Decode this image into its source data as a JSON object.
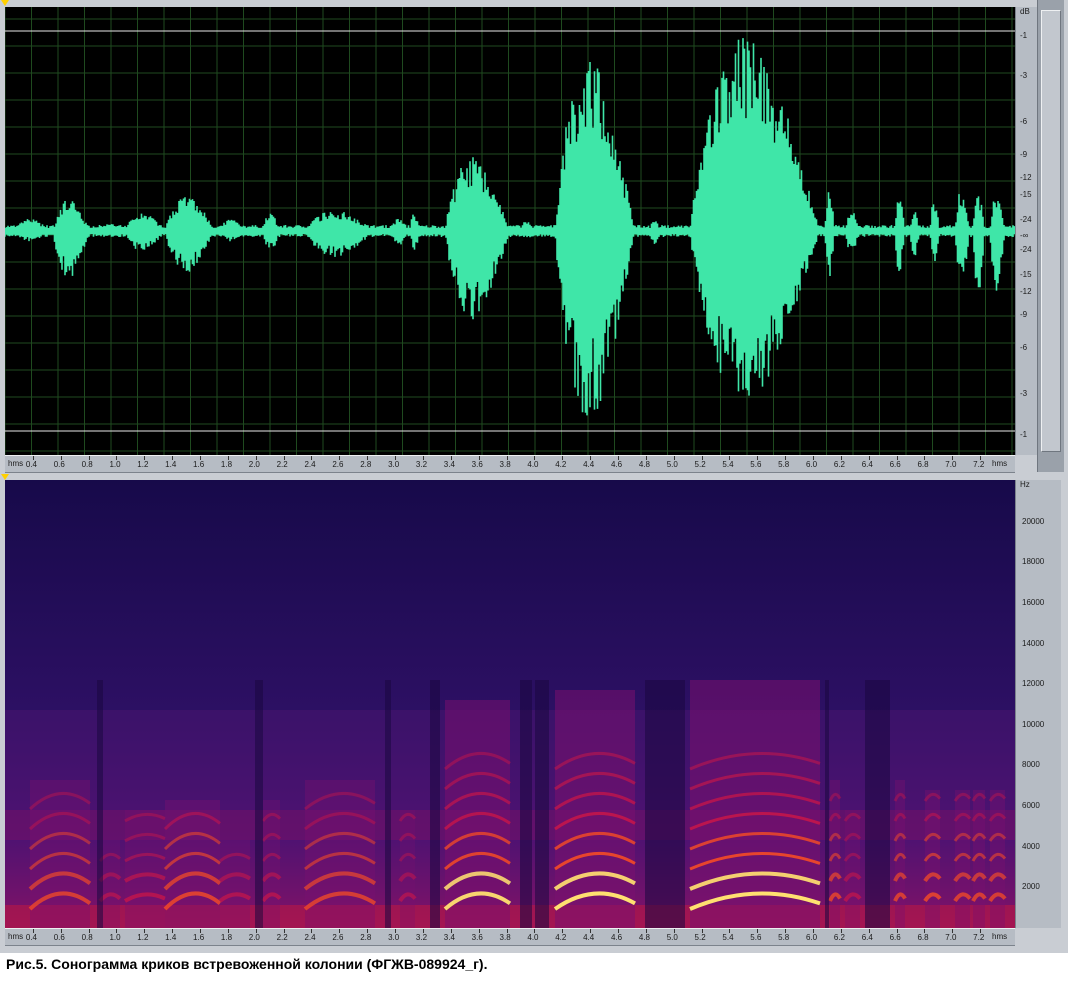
{
  "waveform": {
    "db_unit": "dB",
    "db_labels_top": [
      "-1",
      "-3",
      "-6",
      "-9",
      "-12",
      "-15",
      "-24",
      "-∞",
      "-24",
      "-15",
      "-12",
      "-9",
      "-6",
      "-3",
      "-1"
    ],
    "time_unit": "hms",
    "time_ticks": [
      "0.4",
      "0.6",
      "0.8",
      "1.0",
      "1.2",
      "1.4",
      "1.6",
      "1.8",
      "2.0",
      "2.2",
      "2.4",
      "2.6",
      "2.8",
      "3.0",
      "3.2",
      "3.4",
      "3.6",
      "3.8",
      "4.0",
      "4.2",
      "4.4",
      "4.6",
      "4.8",
      "5.0",
      "5.2",
      "5.4",
      "5.6",
      "5.8",
      "6.0",
      "6.2",
      "6.4",
      "6.6",
      "6.8",
      "7.0",
      "7.2"
    ],
    "color": "#3fe6a8",
    "time_range_s": [
      0.2,
      7.45
    ]
  },
  "spectrogram": {
    "freq_unit": "Hz",
    "freq_labels": [
      "20000",
      "18000",
      "16000",
      "14000",
      "12000",
      "10000",
      "8000",
      "6000",
      "4000",
      "2000"
    ],
    "time_unit": "hms",
    "time_ticks": [
      "0.4",
      "0.6",
      "0.8",
      "1.0",
      "1.2",
      "1.4",
      "1.6",
      "1.8",
      "2.0",
      "2.2",
      "2.4",
      "2.6",
      "2.8",
      "3.0",
      "3.2",
      "3.4",
      "3.6",
      "3.8",
      "4.0",
      "4.2",
      "4.4",
      "4.6",
      "4.8",
      "5.0",
      "5.2",
      "5.4",
      "5.6",
      "5.8",
      "6.0",
      "6.2",
      "6.4",
      "6.6",
      "6.8",
      "7.0",
      "7.2"
    ],
    "freq_range_hz": [
      0,
      22050
    ]
  },
  "caption": "Рис.5. Сонограмма криков встревоженной колонии (ФГЖВ-089924_г)."
}
